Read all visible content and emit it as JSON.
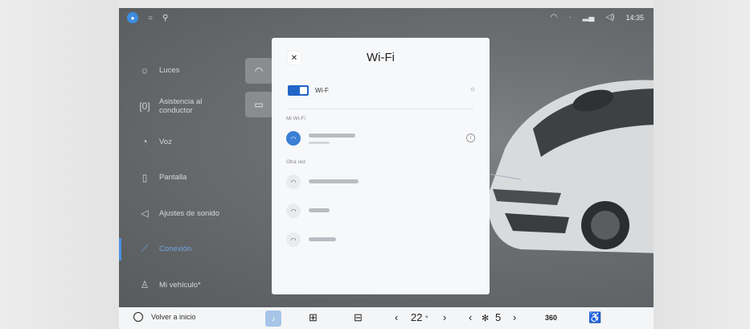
{
  "status_bar": {
    "time": "14:35",
    "icons": [
      "user-icon",
      "refresh-icon",
      "location-icon",
      "wifi-icon",
      "signal-icon",
      "volume-icon"
    ]
  },
  "sidebar": {
    "items": [
      {
        "label": "Luces",
        "icon": "light-icon"
      },
      {
        "label": "Asistencia al conductor",
        "icon": "driver-assist-icon"
      },
      {
        "label": "Voz",
        "icon": "voice-icon"
      },
      {
        "label": "Pantalla",
        "icon": "display-icon"
      },
      {
        "label": "Ajustes de sonido",
        "icon": "sound-icon"
      },
      {
        "label": "Conexión",
        "icon": "connection-icon",
        "active": true
      },
      {
        "label": "Mi vehículo*",
        "icon": "vehicle-icon"
      }
    ]
  },
  "modal": {
    "title": "Wi-Fi",
    "toggle_label": "Wi-F",
    "my_networks_label": "Mi Wi-Fi",
    "other_networks_label": "Otra red"
  },
  "bottom_bar": {
    "home_label": "Volver a inicio",
    "temp_label": "22",
    "fan_label": "5",
    "view_label": "360"
  },
  "colors": {
    "accent": "#2266c8",
    "active_nav": "#6ea6e4"
  }
}
